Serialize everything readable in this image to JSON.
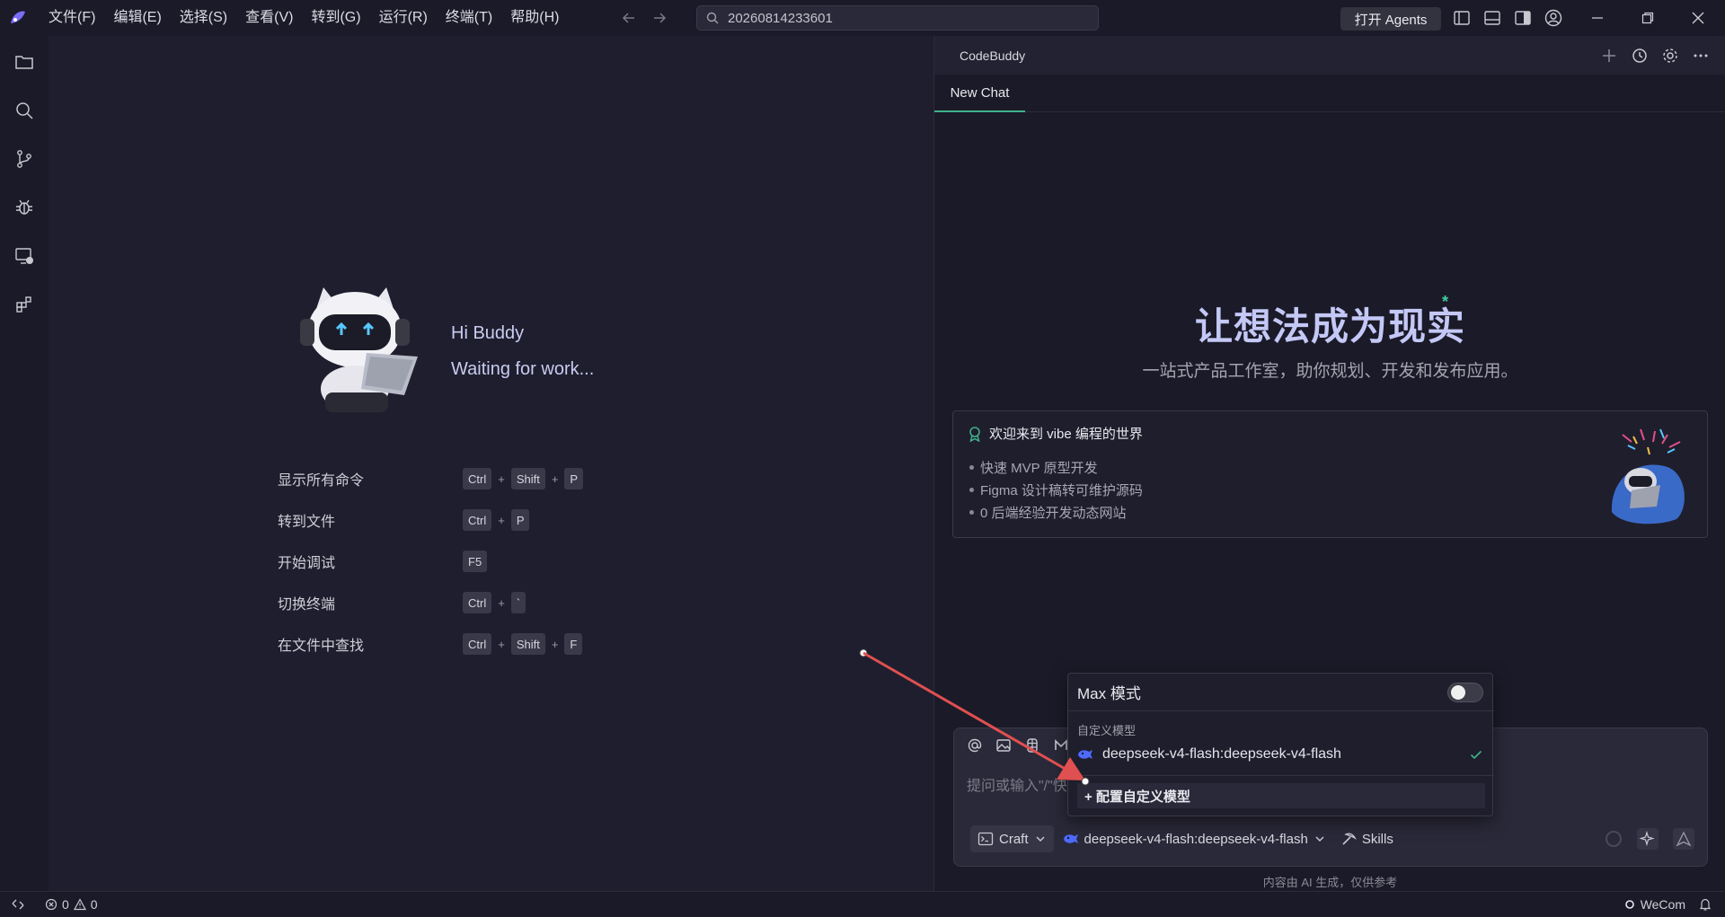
{
  "menu": [
    "文件(F)",
    "编辑(E)",
    "选择(S)",
    "查看(V)",
    "转到(G)",
    "运行(R)",
    "终端(T)",
    "帮助(H)"
  ],
  "search": {
    "value": "20260814233601"
  },
  "agents_button": "打开 Agents",
  "welcome": {
    "greeting": "Hi Buddy",
    "status": "Waiting for work...",
    "shortcuts": [
      {
        "label": "显示所有命令",
        "keys": [
          "Ctrl",
          "Shift",
          "P"
        ]
      },
      {
        "label": "转到文件",
        "keys": [
          "Ctrl",
          "P"
        ]
      },
      {
        "label": "开始调试",
        "keys": [
          "F5"
        ]
      },
      {
        "label": "切换终端",
        "keys": [
          "Ctrl",
          "`"
        ]
      },
      {
        "label": "在文件中查找",
        "keys": [
          "Ctrl",
          "Shift",
          "F"
        ]
      }
    ]
  },
  "chat": {
    "title": "CodeBuddy",
    "tab": "New Chat",
    "hero_title": "让想法成为现实",
    "hero_star": "*",
    "hero_subtitle": "一站式产品工作室，助你规划、开发和发布应用。",
    "card": {
      "title": "欢迎来到 vibe 编程的世界",
      "items": [
        "快速 MVP 原型开发",
        "Figma 设计稿转可维护源码",
        "0 后端经验开发动态网站"
      ]
    },
    "input_placeholder": "提问或输入\"/\"快",
    "mode": "Craft",
    "model": "deepseek-v4-flash:deepseek-v4-flash",
    "skills": "Skills",
    "disclaimer": "内容由 AI 生成，仅供参考"
  },
  "dropdown": {
    "max_mode": "Max 模式",
    "max_mode_enabled": false,
    "section": "自定义模型",
    "option": "deepseek-v4-flash:deepseek-v4-flash",
    "config": "+ 配置自定义模型"
  },
  "statusbar": {
    "errors": "0",
    "warnings": "0",
    "account": "WeCom"
  },
  "colors": {
    "accent": "#3fb38a",
    "annotation": "#e05050",
    "hero": "#c4c8f6"
  }
}
